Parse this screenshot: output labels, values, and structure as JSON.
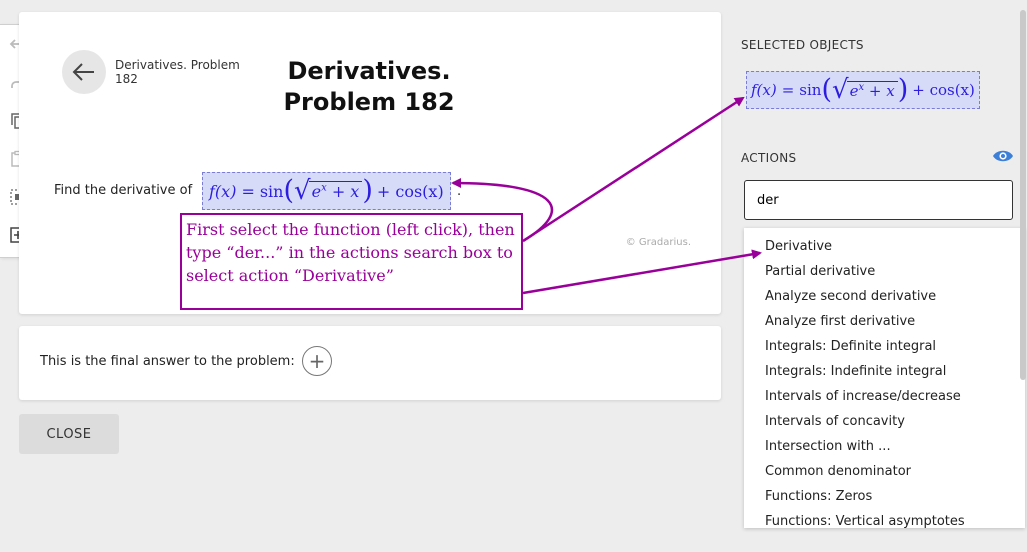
{
  "toolbar": {
    "items": [
      "undo-icon",
      "redo-icon",
      "copy-icon",
      "paste-icon",
      "select-all-icon",
      "add-box-icon"
    ]
  },
  "problem": {
    "header_small": "Derivatives. Problem 182",
    "title_line1": "Derivatives.",
    "title_line2": "Problem 182",
    "prompt": "Find the derivative of",
    "formula": {
      "fn": "f(x)",
      "eq": "=",
      "sin": "sin",
      "e": "e",
      "exp": "x",
      "plus_x": "+ x",
      "plus_cos": "+ cos(x)"
    },
    "period": ".",
    "copyright": "© Gradarius."
  },
  "final": {
    "label": "This is the final answer to the problem:",
    "add_symbol": "+"
  },
  "close_label": "CLOSE",
  "side": {
    "selected_label": "SELECTED OBJECTS",
    "actions_label": "ACTIONS",
    "search_value": "der",
    "options": [
      "Derivative",
      "Partial derivative",
      "Analyze second derivative",
      "Analyze first derivative",
      "Integrals: Definite integral",
      "Integrals: Indefinite integral",
      "Intervals of increase/decrease",
      "Intervals of concavity",
      "Intersection with ...",
      "Common denominator",
      "Functions: Zeros",
      "Functions: Vertical asymptotes"
    ]
  },
  "annotation": {
    "text": "First select the function (left click), then type “der...” in the actions search box to select action “Derivative”",
    "color": "#990099"
  },
  "colors": {
    "formula_text": "#2c1de0",
    "formula_bg": "#d6dcf7",
    "accent_eye": "#3b7fd9"
  }
}
